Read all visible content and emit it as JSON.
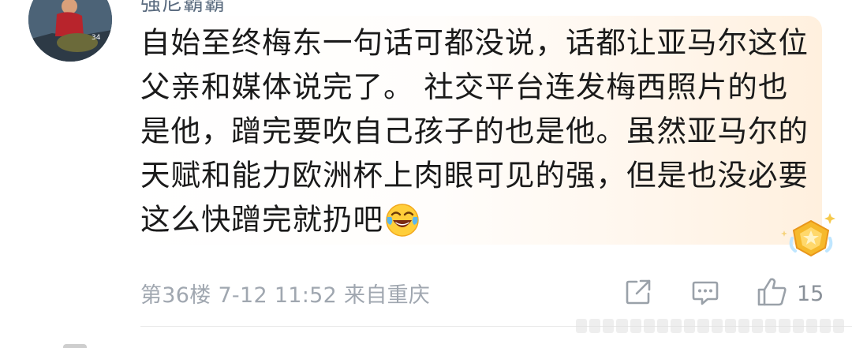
{
  "comment": {
    "username": "强尼霸霸",
    "lines": [
      "自始至终梅东一句话可都没说，话都让亚马尔这位",
      "父亲和媒体说完了。 社交平台连发梅西照片的也",
      "是他，蹭完要吹自己孩子的也是他。虽然亚马尔的",
      "天赋和能力欧洲杯上肉眼可见的强，但是也没必要",
      "这么快蹭完就扔吧"
    ],
    "emoji_icon": "laughing-tears-emoji",
    "floor": "第36楼",
    "datetime": "7-12 11:52",
    "location": "来自重庆",
    "like_count": "15",
    "badge_icon": "gold-star-badge"
  },
  "actions": {
    "share_icon": "share-icon",
    "reply_icon": "comment-icon",
    "like_icon": "thumb-up-icon"
  },
  "colors": {
    "text": "#1a1a1a",
    "username": "#5a6b7f",
    "meta": "#a0a7b0",
    "bubble_highlight": "#fff0de",
    "badge_gold": "#f6b92b"
  }
}
